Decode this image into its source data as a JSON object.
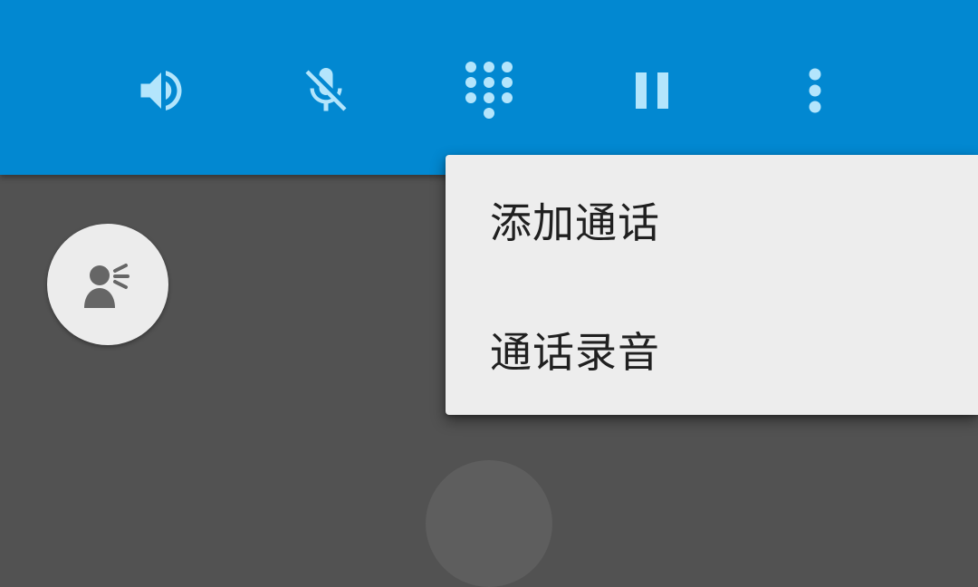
{
  "toolbar": {
    "buttons": [
      {
        "id": "speaker",
        "icon": "speaker-volume-icon"
      },
      {
        "id": "mute",
        "icon": "microphone-off-icon"
      },
      {
        "id": "dialpad",
        "icon": "dialpad-icon"
      },
      {
        "id": "hold",
        "icon": "pause-icon"
      },
      {
        "id": "more",
        "icon": "more-vertical-icon"
      }
    ]
  },
  "conference": {
    "icon": "person-speaking-icon"
  },
  "menu": {
    "items": [
      {
        "label": "添加通话"
      },
      {
        "label": "通话录音"
      }
    ]
  },
  "colors": {
    "toolbar_bg": "#0288D1",
    "icon_tint": "#B3E5FC",
    "content_bg": "#525252",
    "menu_bg": "#EDEDED",
    "menu_text": "#202020"
  }
}
